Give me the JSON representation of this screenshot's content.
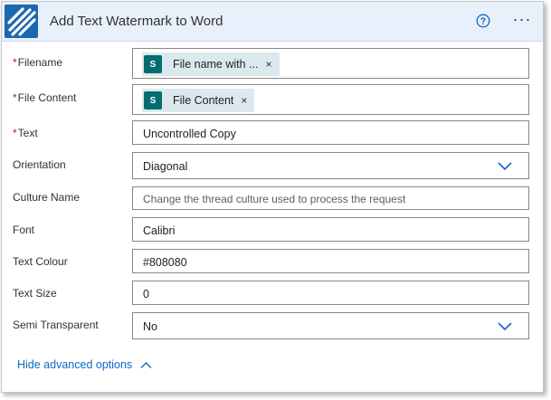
{
  "header": {
    "title": "Add Text Watermark to Word",
    "logo_icon": "striped-connector-logo",
    "help_icon": "help-circle-icon",
    "more_label": "···",
    "accent_color": "#0b6bc6",
    "header_bg": "#e8f0fb"
  },
  "fields": {
    "filename": {
      "label": "Filename",
      "required": true,
      "token_label": "File name with ...",
      "token_icon": "sharepoint-icon",
      "token_close": "×"
    },
    "file_content": {
      "label": "File Content",
      "required": true,
      "token_label": "File Content",
      "token_icon": "sharepoint-icon",
      "token_close": "×"
    },
    "text": {
      "label": "Text",
      "required": true,
      "value": "Uncontrolled Copy"
    },
    "orientation": {
      "label": "Orientation",
      "value": "Diagonal"
    },
    "culture_name": {
      "label": "Culture Name",
      "placeholder": "Change the thread culture used to process the request"
    },
    "font": {
      "label": "Font",
      "value": "Calibri"
    },
    "text_colour": {
      "label": "Text Colour",
      "value": "#808080"
    },
    "text_size": {
      "label": "Text Size",
      "value": "0"
    },
    "semi_transparent": {
      "label": "Semi Transparent",
      "value": "No"
    }
  },
  "required_marker": "*",
  "sharepoint_letter": "S",
  "footer": {
    "hide_advanced_label": "Hide advanced options"
  }
}
